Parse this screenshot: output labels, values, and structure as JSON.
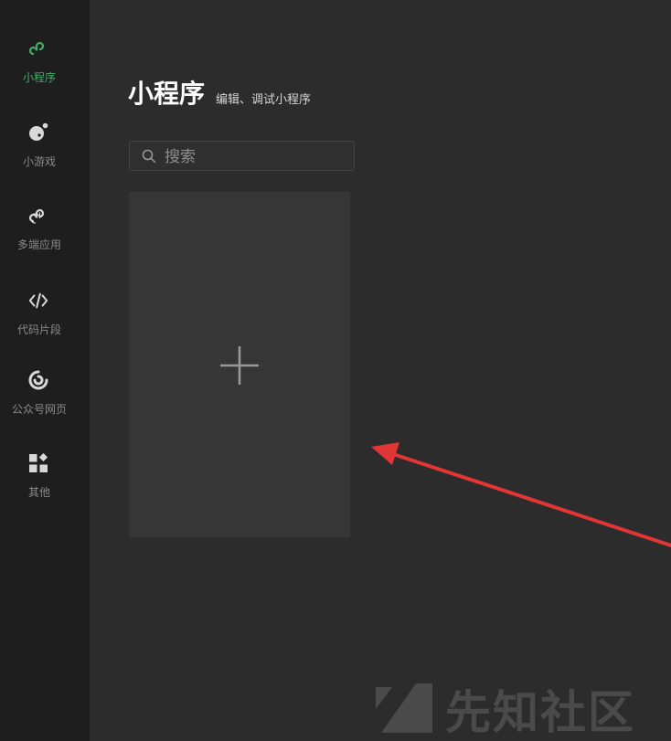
{
  "colors": {
    "sidebar_bg": "#1e1e1e",
    "main_bg": "#2c2c2c",
    "card_bg": "#363636",
    "accent": "#3fb06a",
    "arrow": "#e23535"
  },
  "sidebar": {
    "items": [
      {
        "label": "小程序",
        "icon": "miniprogram-icon",
        "active": true
      },
      {
        "label": "小游戏",
        "icon": "minigame-icon",
        "active": false
      },
      {
        "label": "多端应用",
        "icon": "multiplatform-icon",
        "active": false
      },
      {
        "label": "代码片段",
        "icon": "code-icon",
        "active": false
      },
      {
        "label": "公众号网页",
        "icon": "official-account-icon",
        "active": false
      },
      {
        "label": "其他",
        "icon": "grid-icon",
        "active": false
      }
    ]
  },
  "main": {
    "title": "小程序",
    "subtitle": "编辑、调试小程序",
    "search": {
      "placeholder": "搜索",
      "value": ""
    },
    "new_card": {
      "icon": "plus-icon"
    }
  },
  "watermark": {
    "text": "先知社区",
    "icon": "xianzhi-logo"
  },
  "annotation": {
    "icon": "red-arrow"
  }
}
